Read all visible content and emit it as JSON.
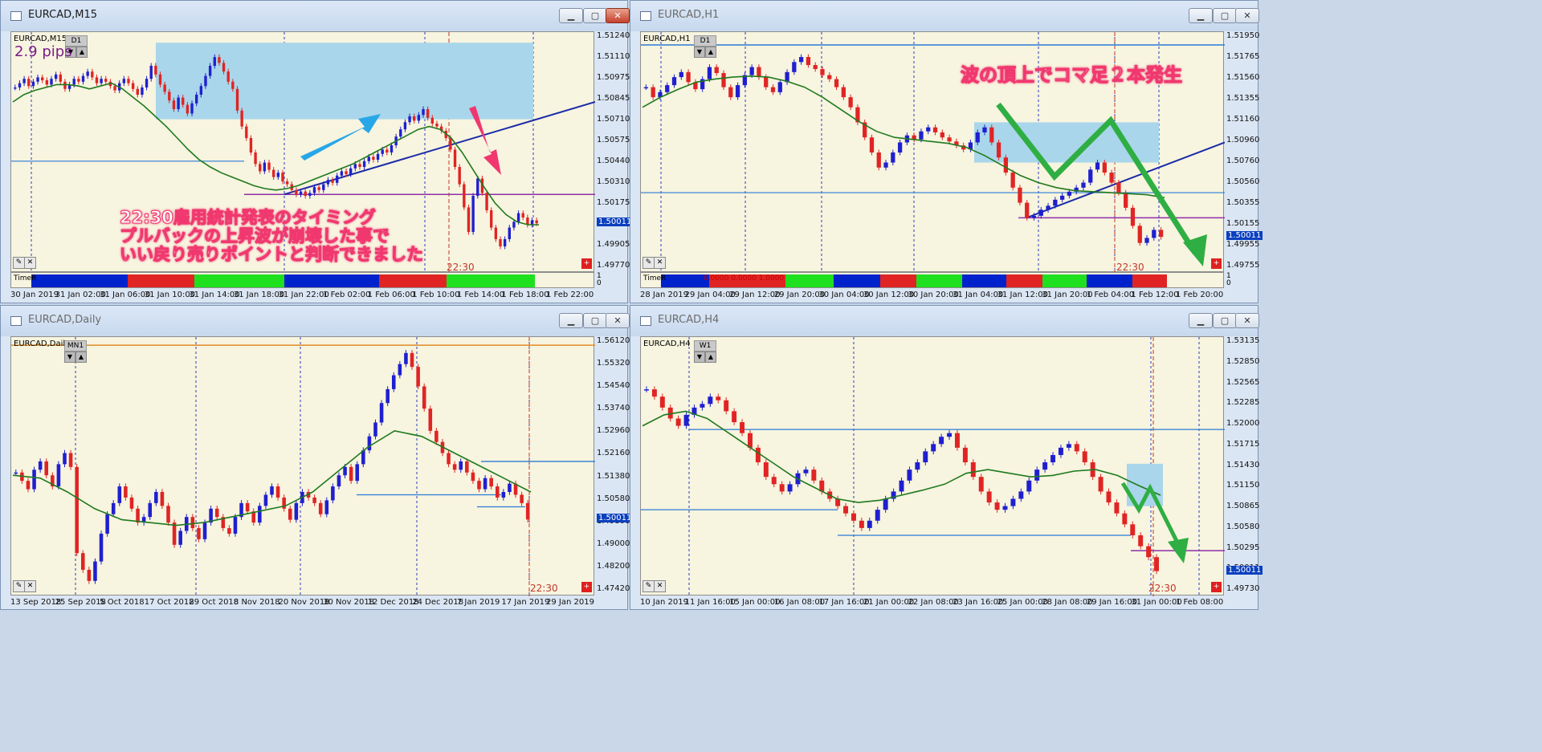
{
  "windows": [
    {
      "id": "m15",
      "title": "EURCAD,M15",
      "header": "EURCAD,M15",
      "tf_box": "D1",
      "pips": "2.9 pips",
      "time_label": "22:30",
      "indicator_label": "TimeR",
      "indicator_min": "0",
      "indicator_max": "1",
      "y_labels": [
        "1.51240",
        "1.51110",
        "1.50975",
        "1.50845",
        "1.50710",
        "1.50575",
        "1.50440",
        "1.50310",
        "1.50175",
        "1.50045",
        "1.49905",
        "1.49770"
      ],
      "current_price": "1.50011",
      "x_labels": [
        "30 Jan 2019",
        "31 Jan 02:00",
        "31 Jan 06:00",
        "31 Jan 10:00",
        "31 Jan 14:00",
        "31 Jan 18:00",
        "31 Jan 22:00",
        "1 Feb 02:00",
        "1 Feb 06:00",
        "1 Feb 10:00",
        "1 Feb 14:00",
        "1 Feb 18:00",
        "1 Feb 22:00"
      ],
      "annotation": [
        "22:30雇用統計発表のタイミング",
        "プルバックの上昇波が崩壊した事で",
        "いい戻り売りポイントと判断できました"
      ],
      "colors": {
        "up": "#1f1fd0",
        "down": "#e02424",
        "ma": "#1f7a1f",
        "zone": "#a9d6ea"
      }
    },
    {
      "id": "h1",
      "title": "EURCAD,H1",
      "header": "EURCAD,H1",
      "tf_box": "D1",
      "time_label": "22:30",
      "indicator_label": "TimeR",
      "indicator_min": "0",
      "indicator_max": "1",
      "indicator_values": "0.0000 0.0000 1.0000",
      "y_labels": [
        "1.51950",
        "1.51765",
        "1.51560",
        "1.51355",
        "1.51160",
        "1.50960",
        "1.50760",
        "1.50560",
        "1.50355",
        "1.50155",
        "1.49955",
        "1.49755"
      ],
      "current_price": "1.50011",
      "x_labels": [
        "28 Jan 2019",
        "29 Jan 04:00",
        "29 Jan 12:00",
        "29 Jan 20:00",
        "30 Jan 04:00",
        "30 Jan 12:00",
        "30 Jan 20:00",
        "31 Jan 04:00",
        "31 Jan 12:00",
        "31 Jan 20:00",
        "1 Feb 04:00",
        "1 Feb 12:00",
        "1 Feb 20:00"
      ],
      "annotation": [
        "波の頂上でコマ足２本発生"
      ]
    },
    {
      "id": "daily",
      "title": "EURCAD,Daily",
      "header": "EURCAD,Daily",
      "tf_box": "MN1",
      "time_label": "22:30",
      "y_labels": [
        "1.56120",
        "1.55320",
        "1.54540",
        "1.53740",
        "1.52960",
        "1.52160",
        "1.51380",
        "1.50580",
        "1.49800",
        "1.49000",
        "1.48200",
        "1.47420"
      ],
      "current_price": "1.50011",
      "x_labels": [
        "13 Sep 2018",
        "25 Sep 2018",
        "5 Oct 2018",
        "17 Oct 2018",
        "29 Oct 2018",
        "8 Nov 2018",
        "20 Nov 2018",
        "30 Nov 2018",
        "12 Dec 2018",
        "24 Dec 2018",
        "7 Jan 2019",
        "17 Jan 2019",
        "29 Jan 2019"
      ]
    },
    {
      "id": "h4",
      "title": "EURCAD,H4",
      "header": "EURCAD,H4",
      "tf_box": "W1",
      "time_label": "22:30",
      "y_labels": [
        "1.53135",
        "1.52850",
        "1.52565",
        "1.52285",
        "1.52000",
        "1.51715",
        "1.51430",
        "1.51150",
        "1.50865",
        "1.50580",
        "1.50295",
        "1.50011",
        "1.49730"
      ],
      "current_price": "1.50011",
      "x_labels": [
        "10 Jan 2019",
        "11 Jan 16:00",
        "15 Jan 00:00",
        "16 Jan 08:00",
        "17 Jan 16:00",
        "21 Jan 00:00",
        "22 Jan 08:00",
        "23 Jan 16:00",
        "25 Jan 00:00",
        "28 Jan 08:00",
        "29 Jan 16:00",
        "31 Jan 00:00",
        "1 Feb 08:00"
      ]
    }
  ],
  "chart_data": [
    {
      "type": "candlestick",
      "title": "EURCAD,M15",
      "ylim": [
        1.497,
        1.513
      ],
      "closes": [
        1.5095,
        1.5098,
        1.5101,
        1.5096,
        1.5099,
        1.5102,
        1.51,
        1.5097,
        1.5101,
        1.5104,
        1.5099,
        1.5094,
        1.5097,
        1.5101,
        1.5099,
        1.5103,
        1.5106,
        1.5102,
        1.5098,
        1.5101,
        1.5099,
        1.5096,
        1.5093,
        1.5098,
        1.5101,
        1.5098,
        1.5094,
        1.509,
        1.5095,
        1.5101,
        1.511,
        1.5104,
        1.5097,
        1.5092,
        1.5086,
        1.508,
        1.5088,
        1.5083,
        1.5077,
        1.5084,
        1.509,
        1.5096,
        1.5103,
        1.511,
        1.5116,
        1.5112,
        1.5106,
        1.5099,
        1.5094,
        1.5079,
        1.5068,
        1.506,
        1.505,
        1.5042,
        1.5037,
        1.5043,
        1.5038,
        1.5033,
        1.5036,
        1.503,
        1.5028,
        1.5024,
        1.5021,
        1.5023,
        1.502,
        1.5022,
        1.5026,
        1.5024,
        1.5028,
        1.5031,
        1.5029,
        1.5034,
        1.5037,
        1.5035,
        1.5039,
        1.5042,
        1.504,
        1.5044,
        1.5047,
        1.5045,
        1.5049,
        1.5052,
        1.505,
        1.5055,
        1.5061,
        1.5066,
        1.5071,
        1.5075,
        1.5072,
        1.5076,
        1.508,
        1.5074,
        1.507,
        1.5068,
        1.5065,
        1.506,
        1.5052,
        1.504,
        1.5028,
        1.5012,
        1.4995,
        1.502,
        1.5032,
        1.5022,
        1.501,
        1.4998,
        1.499,
        1.4985,
        1.499,
        1.4998,
        1.5002,
        1.5008,
        1.5005,
        1.5,
        1.5003,
        1.5001
      ],
      "ma": [
        1.5085,
        1.509,
        1.5093,
        1.5095,
        1.5097,
        1.5097,
        1.5096,
        1.5094,
        1.5096,
        1.5098,
        1.5094,
        1.5088,
        1.5082,
        1.5075,
        1.5068,
        1.506,
        1.5052,
        1.5045,
        1.504,
        1.5036,
        1.5033,
        1.503,
        1.5027,
        1.5025,
        1.5024,
        1.5025,
        1.5027,
        1.503,
        1.5033,
        1.5036,
        1.5039,
        1.5042,
        1.5046,
        1.505,
        1.5054,
        1.5058,
        1.5062,
        1.5066,
        1.5068,
        1.5066,
        1.506,
        1.505,
        1.5038,
        1.5026,
        1.5015,
        1.5007,
        1.5002,
        1.5,
        1.5
      ],
      "annotations": {
        "zone": [
          1.5073,
          1.5126
        ],
        "trendline": [
          1.5021,
          1.5085
        ],
        "purple_line": 1.5021,
        "blue_line": 1.5044
      }
    },
    {
      "type": "candlestick",
      "title": "EURCAD,H1",
      "ylim": [
        1.497,
        1.52
      ],
      "closes": [
        1.515,
        1.514,
        1.5145,
        1.5152,
        1.516,
        1.5165,
        1.5155,
        1.5148,
        1.5158,
        1.517,
        1.5164,
        1.515,
        1.514,
        1.5152,
        1.5162,
        1.517,
        1.516,
        1.515,
        1.5145,
        1.5155,
        1.5165,
        1.5175,
        1.518,
        1.5172,
        1.5168,
        1.5162,
        1.5158,
        1.515,
        1.514,
        1.513,
        1.5115,
        1.51,
        1.5085,
        1.507,
        1.5075,
        1.5085,
        1.5095,
        1.5102,
        1.5098,
        1.5106,
        1.511,
        1.5105,
        1.51,
        1.5096,
        1.5092,
        1.5088,
        1.5095,
        1.5105,
        1.511,
        1.5095,
        1.508,
        1.5065,
        1.505,
        1.5035,
        1.502,
        1.5022,
        1.5028,
        1.5032,
        1.5038,
        1.5042,
        1.5046,
        1.505,
        1.5055,
        1.5068,
        1.5075,
        1.5065,
        1.5055,
        1.5045,
        1.503,
        1.5012,
        1.4995,
        1.5,
        1.5008,
        1.5001
      ],
      "ma": [
        1.513,
        1.514,
        1.5148,
        1.5155,
        1.5158,
        1.516,
        1.5161,
        1.516,
        1.5156,
        1.515,
        1.514,
        1.5128,
        1.5116,
        1.5106,
        1.51,
        1.5098,
        1.5096,
        1.5094,
        1.509,
        1.5082,
        1.5072,
        1.5062,
        1.5055,
        1.505,
        1.5047,
        1.5046,
        1.5045,
        1.5044,
        1.5043,
        1.504
      ],
      "annotations": {
        "zone": [
          1.5075,
          1.5115
        ],
        "trendline": [
          1.502,
          1.5095
        ],
        "purple_line": 1.502,
        "blue_line": 1.5045,
        "top_line": 1.5192
      }
    },
    {
      "type": "candlestick",
      "title": "EURCAD,Daily",
      "ylim": [
        1.4742,
        1.564
      ],
      "closes": [
        1.517,
        1.514,
        1.511,
        1.518,
        1.521,
        1.516,
        1.512,
        1.52,
        1.524,
        1.519,
        1.488,
        1.482,
        1.478,
        1.485,
        1.495,
        1.502,
        1.506,
        1.512,
        1.508,
        1.504,
        1.499,
        1.501,
        1.506,
        1.51,
        1.505,
        1.499,
        1.491,
        1.496,
        1.501,
        1.497,
        1.493,
        1.499,
        1.504,
        1.501,
        1.497,
        1.495,
        1.501,
        1.506,
        1.503,
        1.499,
        1.505,
        1.509,
        1.512,
        1.508,
        1.504,
        1.5,
        1.506,
        1.51,
        1.508,
        1.506,
        1.502,
        1.507,
        1.512,
        1.516,
        1.519,
        1.514,
        1.52,
        1.525,
        1.53,
        1.535,
        1.542,
        1.547,
        1.552,
        1.556,
        1.56,
        1.555,
        1.548,
        1.54,
        1.532,
        1.528,
        1.524,
        1.52,
        1.518,
        1.521,
        1.517,
        1.514,
        1.511,
        1.515,
        1.512,
        1.508,
        1.51,
        1.513,
        1.509,
        1.506,
        1.5001
      ],
      "ma": [
        1.516,
        1.515,
        1.51,
        1.504,
        1.5,
        1.499,
        1.498,
        1.499,
        1.501,
        1.503,
        1.505,
        1.51,
        1.518,
        1.526,
        1.532,
        1.53,
        1.525,
        1.52,
        1.515,
        1.51
      ],
      "annotations": {
        "upper_line": 1.521,
        "lower_line": 1.509,
        "top_line": 1.5628
      }
    },
    {
      "type": "candlestick",
      "title": "EURCAD,H4",
      "ylim": [
        1.4973,
        1.5315
      ],
      "closes": [
        1.525,
        1.524,
        1.5225,
        1.521,
        1.52,
        1.5215,
        1.5225,
        1.523,
        1.524,
        1.5235,
        1.522,
        1.5205,
        1.519,
        1.517,
        1.515,
        1.513,
        1.512,
        1.511,
        1.512,
        1.5135,
        1.514,
        1.5125,
        1.511,
        1.51,
        1.509,
        1.508,
        1.507,
        1.506,
        1.507,
        1.5085,
        1.51,
        1.511,
        1.5125,
        1.514,
        1.515,
        1.5165,
        1.5175,
        1.5185,
        1.519,
        1.517,
        1.515,
        1.513,
        1.511,
        1.5095,
        1.5085,
        1.509,
        1.51,
        1.511,
        1.5125,
        1.514,
        1.515,
        1.516,
        1.517,
        1.5175,
        1.5165,
        1.515,
        1.513,
        1.511,
        1.5095,
        1.508,
        1.5065,
        1.505,
        1.5035,
        1.502,
        1.5001
      ],
      "ma": [
        1.52,
        1.5215,
        1.522,
        1.521,
        1.519,
        1.517,
        1.515,
        1.513,
        1.5115,
        1.51,
        1.5095,
        1.5098,
        1.5105,
        1.5112,
        1.512,
        1.5135,
        1.514,
        1.5135,
        1.513,
        1.5132,
        1.5138,
        1.514,
        1.5132,
        1.5118,
        1.5105
      ],
      "annotations": {
        "zone": [
          1.509,
          1.5148
        ],
        "purple_line": 1.5029,
        "blue_line_top": 1.5195,
        "blue_line_mid": 1.5085,
        "blue_line_low": 1.505
      }
    }
  ]
}
